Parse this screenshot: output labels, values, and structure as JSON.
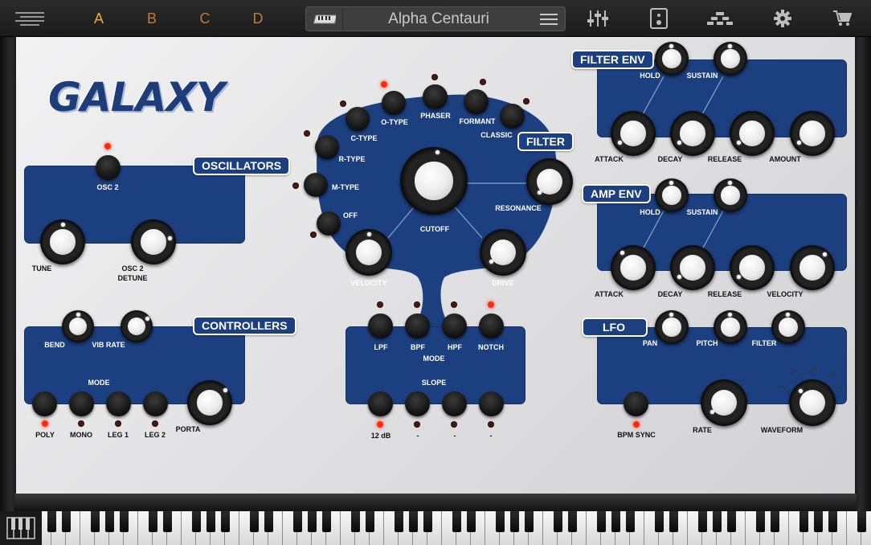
{
  "topbar": {
    "slots": [
      "A",
      "B",
      "C",
      "D"
    ],
    "active_slot": "A",
    "preset_name": "Alpha Centauri",
    "icons": [
      "menu-icon",
      "keyboard-icon",
      "hamburger-icon",
      "mixer-sliders-icon",
      "stompbox-icon",
      "blocks-icon",
      "gear-icon",
      "cart-icon"
    ]
  },
  "logo": "GALAXY",
  "oscillators": {
    "title": "OSCILLATORS",
    "osc2": "OSC 2",
    "tune": "TUNE",
    "osc2_detune_line1": "OSC 2",
    "osc2_detune_line2": "DETUNE"
  },
  "controllers": {
    "title": "CONTROLLERS",
    "bend": "BEND",
    "vib_rate": "VIB RATE",
    "mode": "MODE",
    "modes": [
      "POLY",
      "MONO",
      "LEG 1",
      "LEG 2"
    ],
    "porta": "PORTA"
  },
  "filter": {
    "title": "FILTER",
    "types": [
      "OFF",
      "M-TYPE",
      "R-TYPE",
      "C-TYPE",
      "O-TYPE",
      "PHASER",
      "FORMANT",
      "CLASSIC"
    ],
    "cutoff": "CUTOFF",
    "resonance": "RESONANCE",
    "velocity": "VELOCITY",
    "drive": "DRIVE",
    "mode_label": "MODE",
    "modes": [
      "LPF",
      "BPF",
      "HPF",
      "NOTCH"
    ],
    "slope_label": "SLOPE",
    "slopes": [
      "12 dB",
      "-",
      "-",
      "-"
    ]
  },
  "filter_env": {
    "title": "FILTER ENV",
    "hold": "HOLD",
    "sustain": "SUSTAIN",
    "attack": "ATTACK",
    "decay": "DECAY",
    "release": "RELEASE",
    "amount": "AMOUNT"
  },
  "amp_env": {
    "title": "AMP ENV",
    "hold": "HOLD",
    "sustain": "SUSTAIN",
    "attack": "ATTACK",
    "decay": "DECAY",
    "release": "RELEASE",
    "velocity": "VELOCITY"
  },
  "lfo": {
    "title": "LFO",
    "pan": "PAN",
    "pitch": "PITCH",
    "filter": "FILTER",
    "rate": "RATE",
    "waveform": "WAVEFORM",
    "bpm_sync": "BPM SYNC"
  },
  "colors": {
    "panel_blue": "#1c3f80",
    "active_slot": "#f0a93d",
    "led_on": "#ff2a10"
  }
}
